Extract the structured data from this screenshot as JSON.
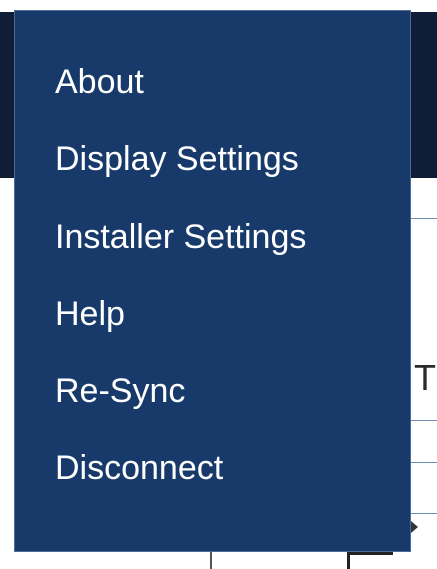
{
  "menu": {
    "items": [
      {
        "label": "About"
      },
      {
        "label": "Display Settings"
      },
      {
        "label": "Installer Settings"
      },
      {
        "label": "Help"
      },
      {
        "label": "Re-Sync"
      },
      {
        "label": "Disconnect"
      }
    ],
    "background_color": "#183a6b",
    "text_color": "#ffffff"
  },
  "background": {
    "partial_text": "T",
    "header_color": "#101d36"
  }
}
